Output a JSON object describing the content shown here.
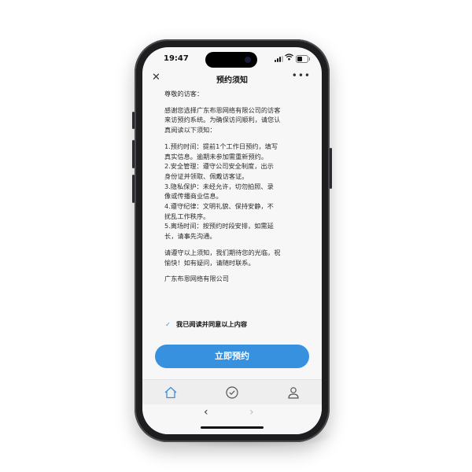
{
  "status_bar": {
    "time": "19:47"
  },
  "navbar": {
    "close_icon": "close-icon",
    "title": "预约须知",
    "more_label": "•••"
  },
  "content": {
    "lines": [
      "尊敬的访客：",
      "感谢您选择广东布恩网络有限公司的访客",
      "来访预约系统。为确保访问顺利，请您认",
      "真阅读以下须知：",
      "1.预约时间：提前1个工作日预约，填写",
      "真实信息。逾期未参加需重新预约。",
      "2.安全管理：遵守公司安全制度，出示",
      "身份证并领取、佩戴访客证。",
      "3.隐私保护：未经允许，切勿拍照、录",
      "像或传播商业信息。",
      "4.遵守纪律：文明礼貌、保持安静，不",
      "扰乱工作秩序。",
      "5.离场时间：按预约时段安排，如需延",
      "长，请事先沟通。",
      "请遵守以上须知，我们期待您的光临，祝",
      "愉快！如有疑问，请随时联系。",
      "广东布恩网络有限公司"
    ]
  },
  "agreement": {
    "checked": true,
    "label": "我已阅读并同意以上内容"
  },
  "cta": {
    "label": "立即预约",
    "color": "#3891df"
  },
  "tabbar": {
    "items": [
      "home-icon",
      "check-circle-icon",
      "user-icon"
    ],
    "active_color": "#3a8fe0"
  },
  "browser": {
    "back": "‹",
    "forward": "›"
  }
}
